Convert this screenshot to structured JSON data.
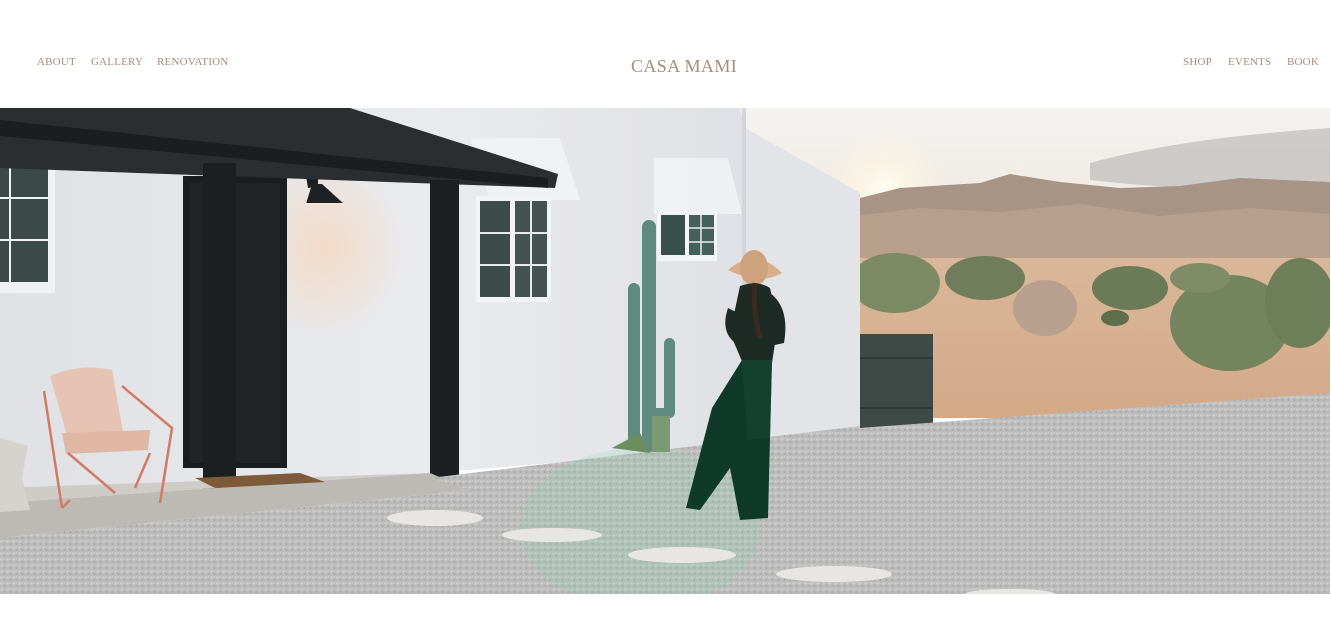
{
  "nav": {
    "left": [
      {
        "label": "ABOUT"
      },
      {
        "label": "GALLERY"
      },
      {
        "label": "RENOVATION"
      }
    ],
    "right": [
      {
        "label": "SHOP"
      },
      {
        "label": "EVENTS"
      },
      {
        "label": "BOOK"
      }
    ]
  },
  "brand": {
    "title": "CASA MAMI"
  },
  "colors": {
    "nav_text": "#a48e7a",
    "background": "#ffffff"
  }
}
